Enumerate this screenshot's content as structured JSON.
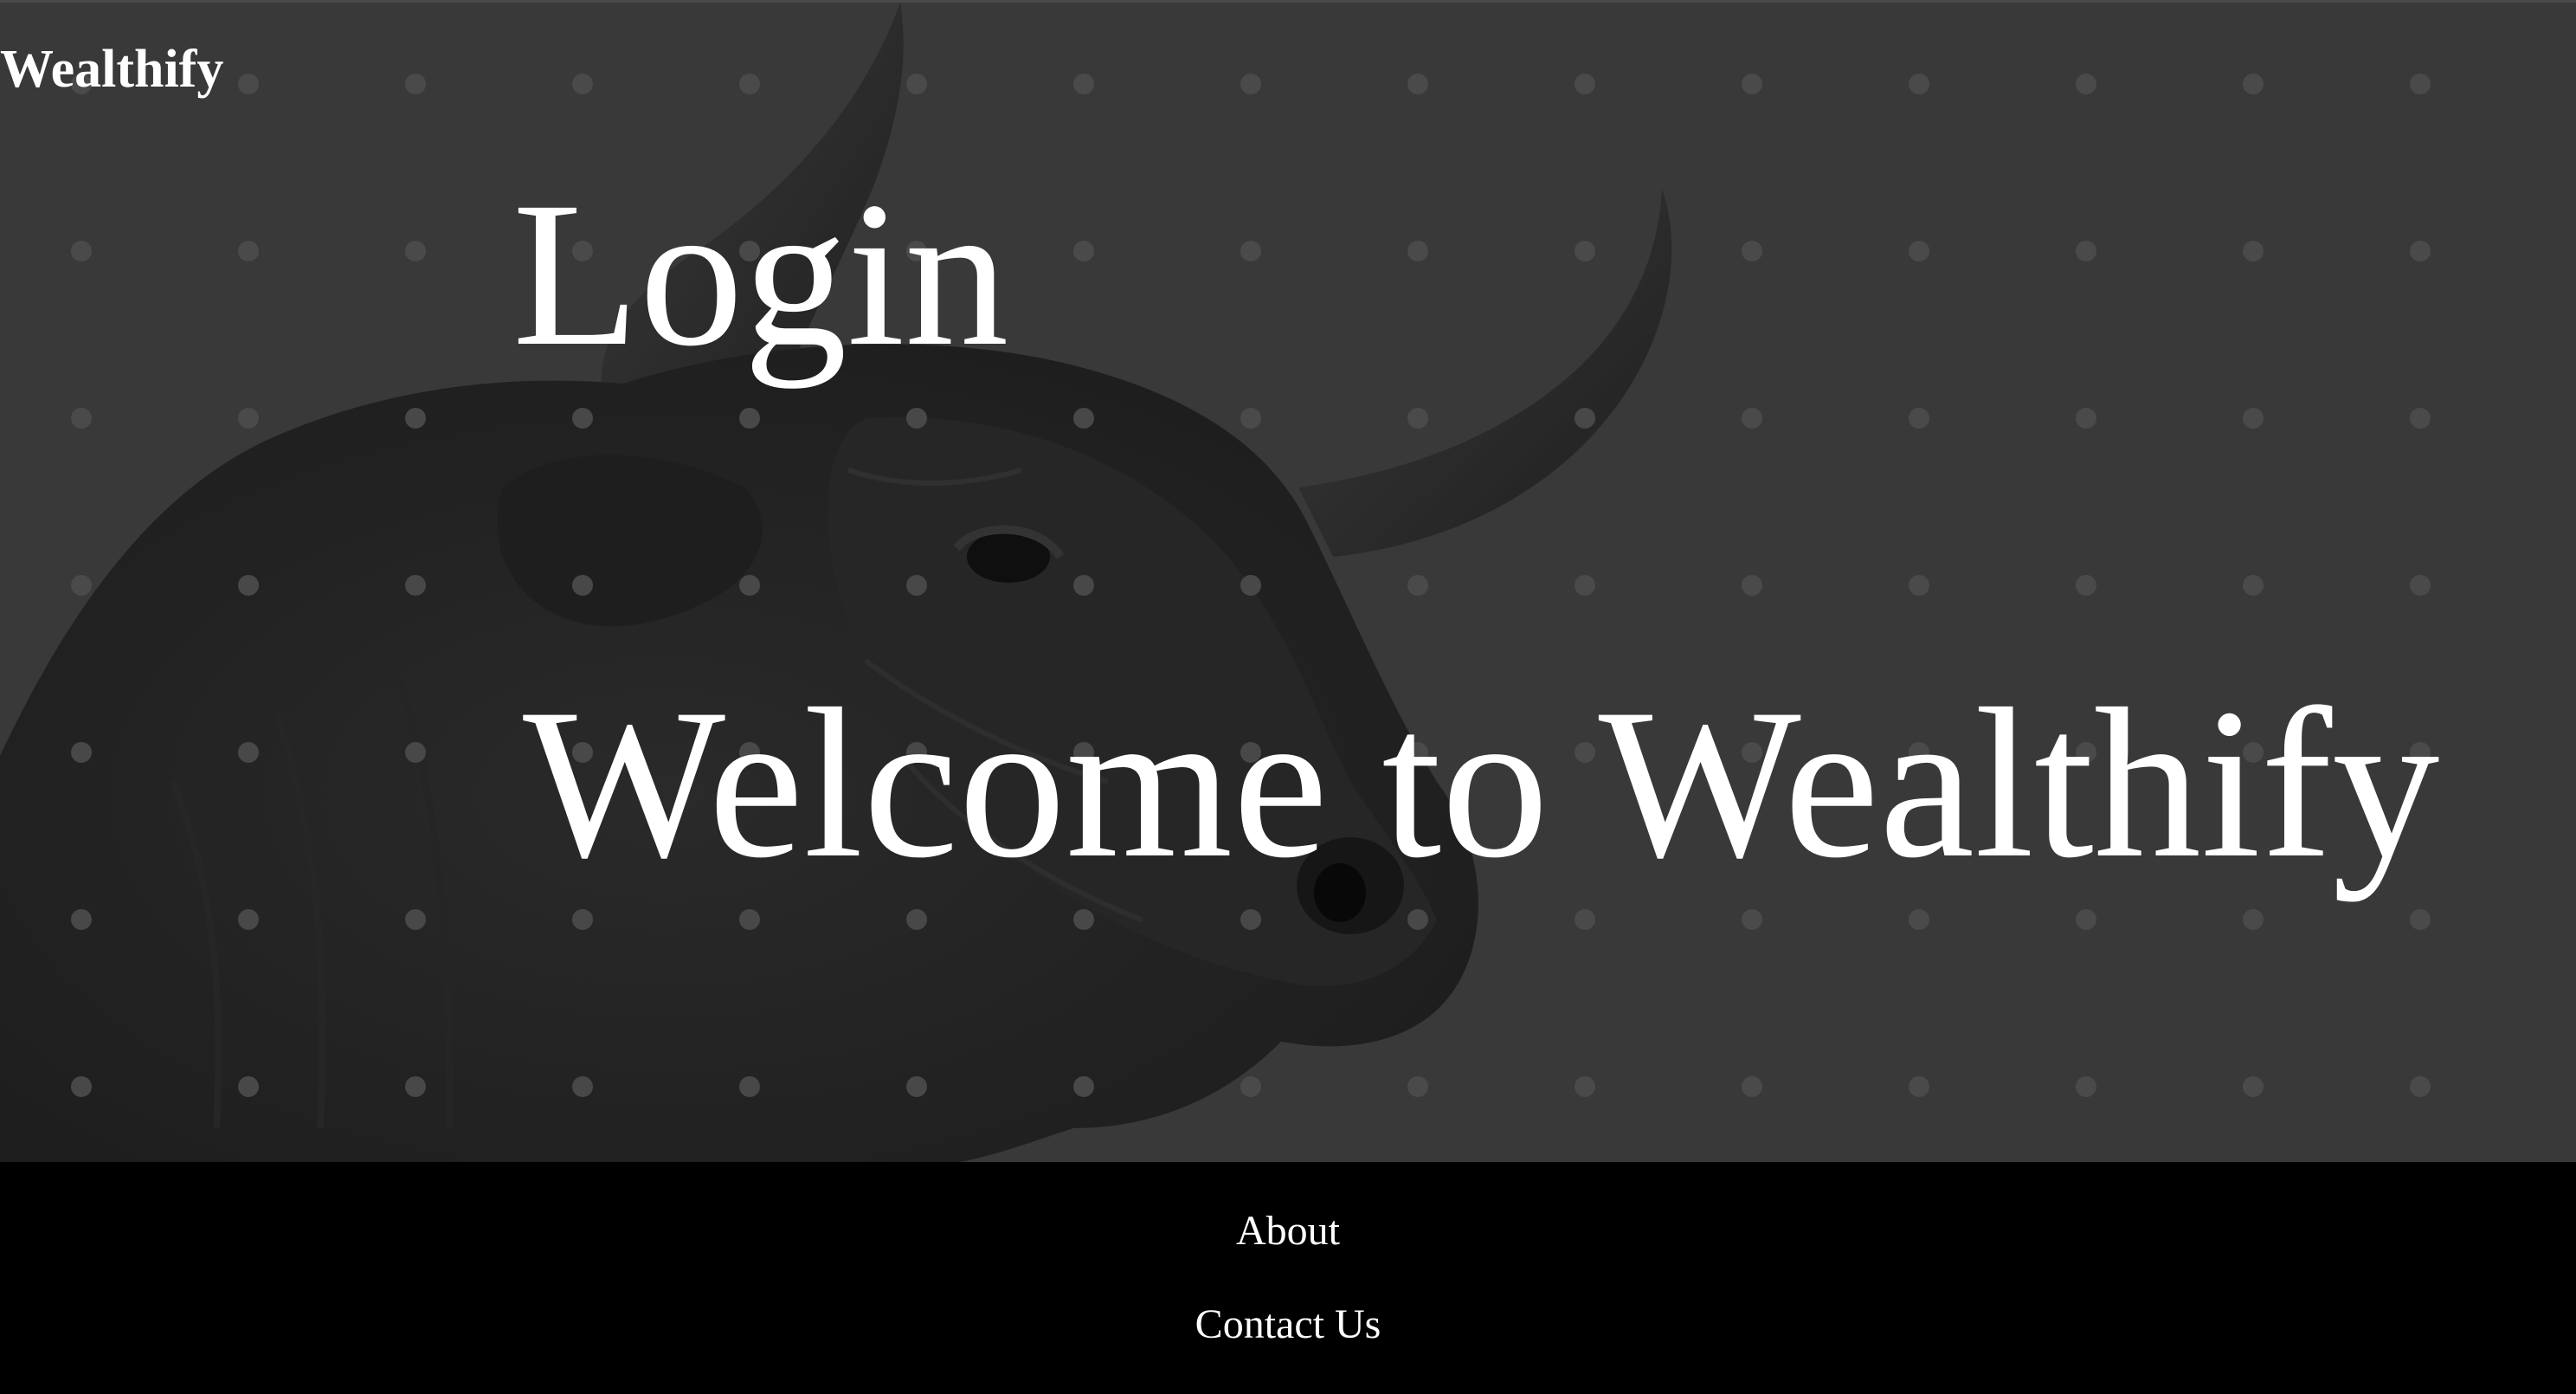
{
  "brand": {
    "name": "Wealthify"
  },
  "nav": {
    "login_label": "Login"
  },
  "hero": {
    "headline": "Welcome to Wealthify",
    "background_image": "bull-photo",
    "background_color": "#393939"
  },
  "footer": {
    "about_label": "About",
    "contact_label": "Contact Us",
    "background_color": "#000000"
  },
  "colors": {
    "text": "#ffffff",
    "dots": "#4d4d4d"
  }
}
